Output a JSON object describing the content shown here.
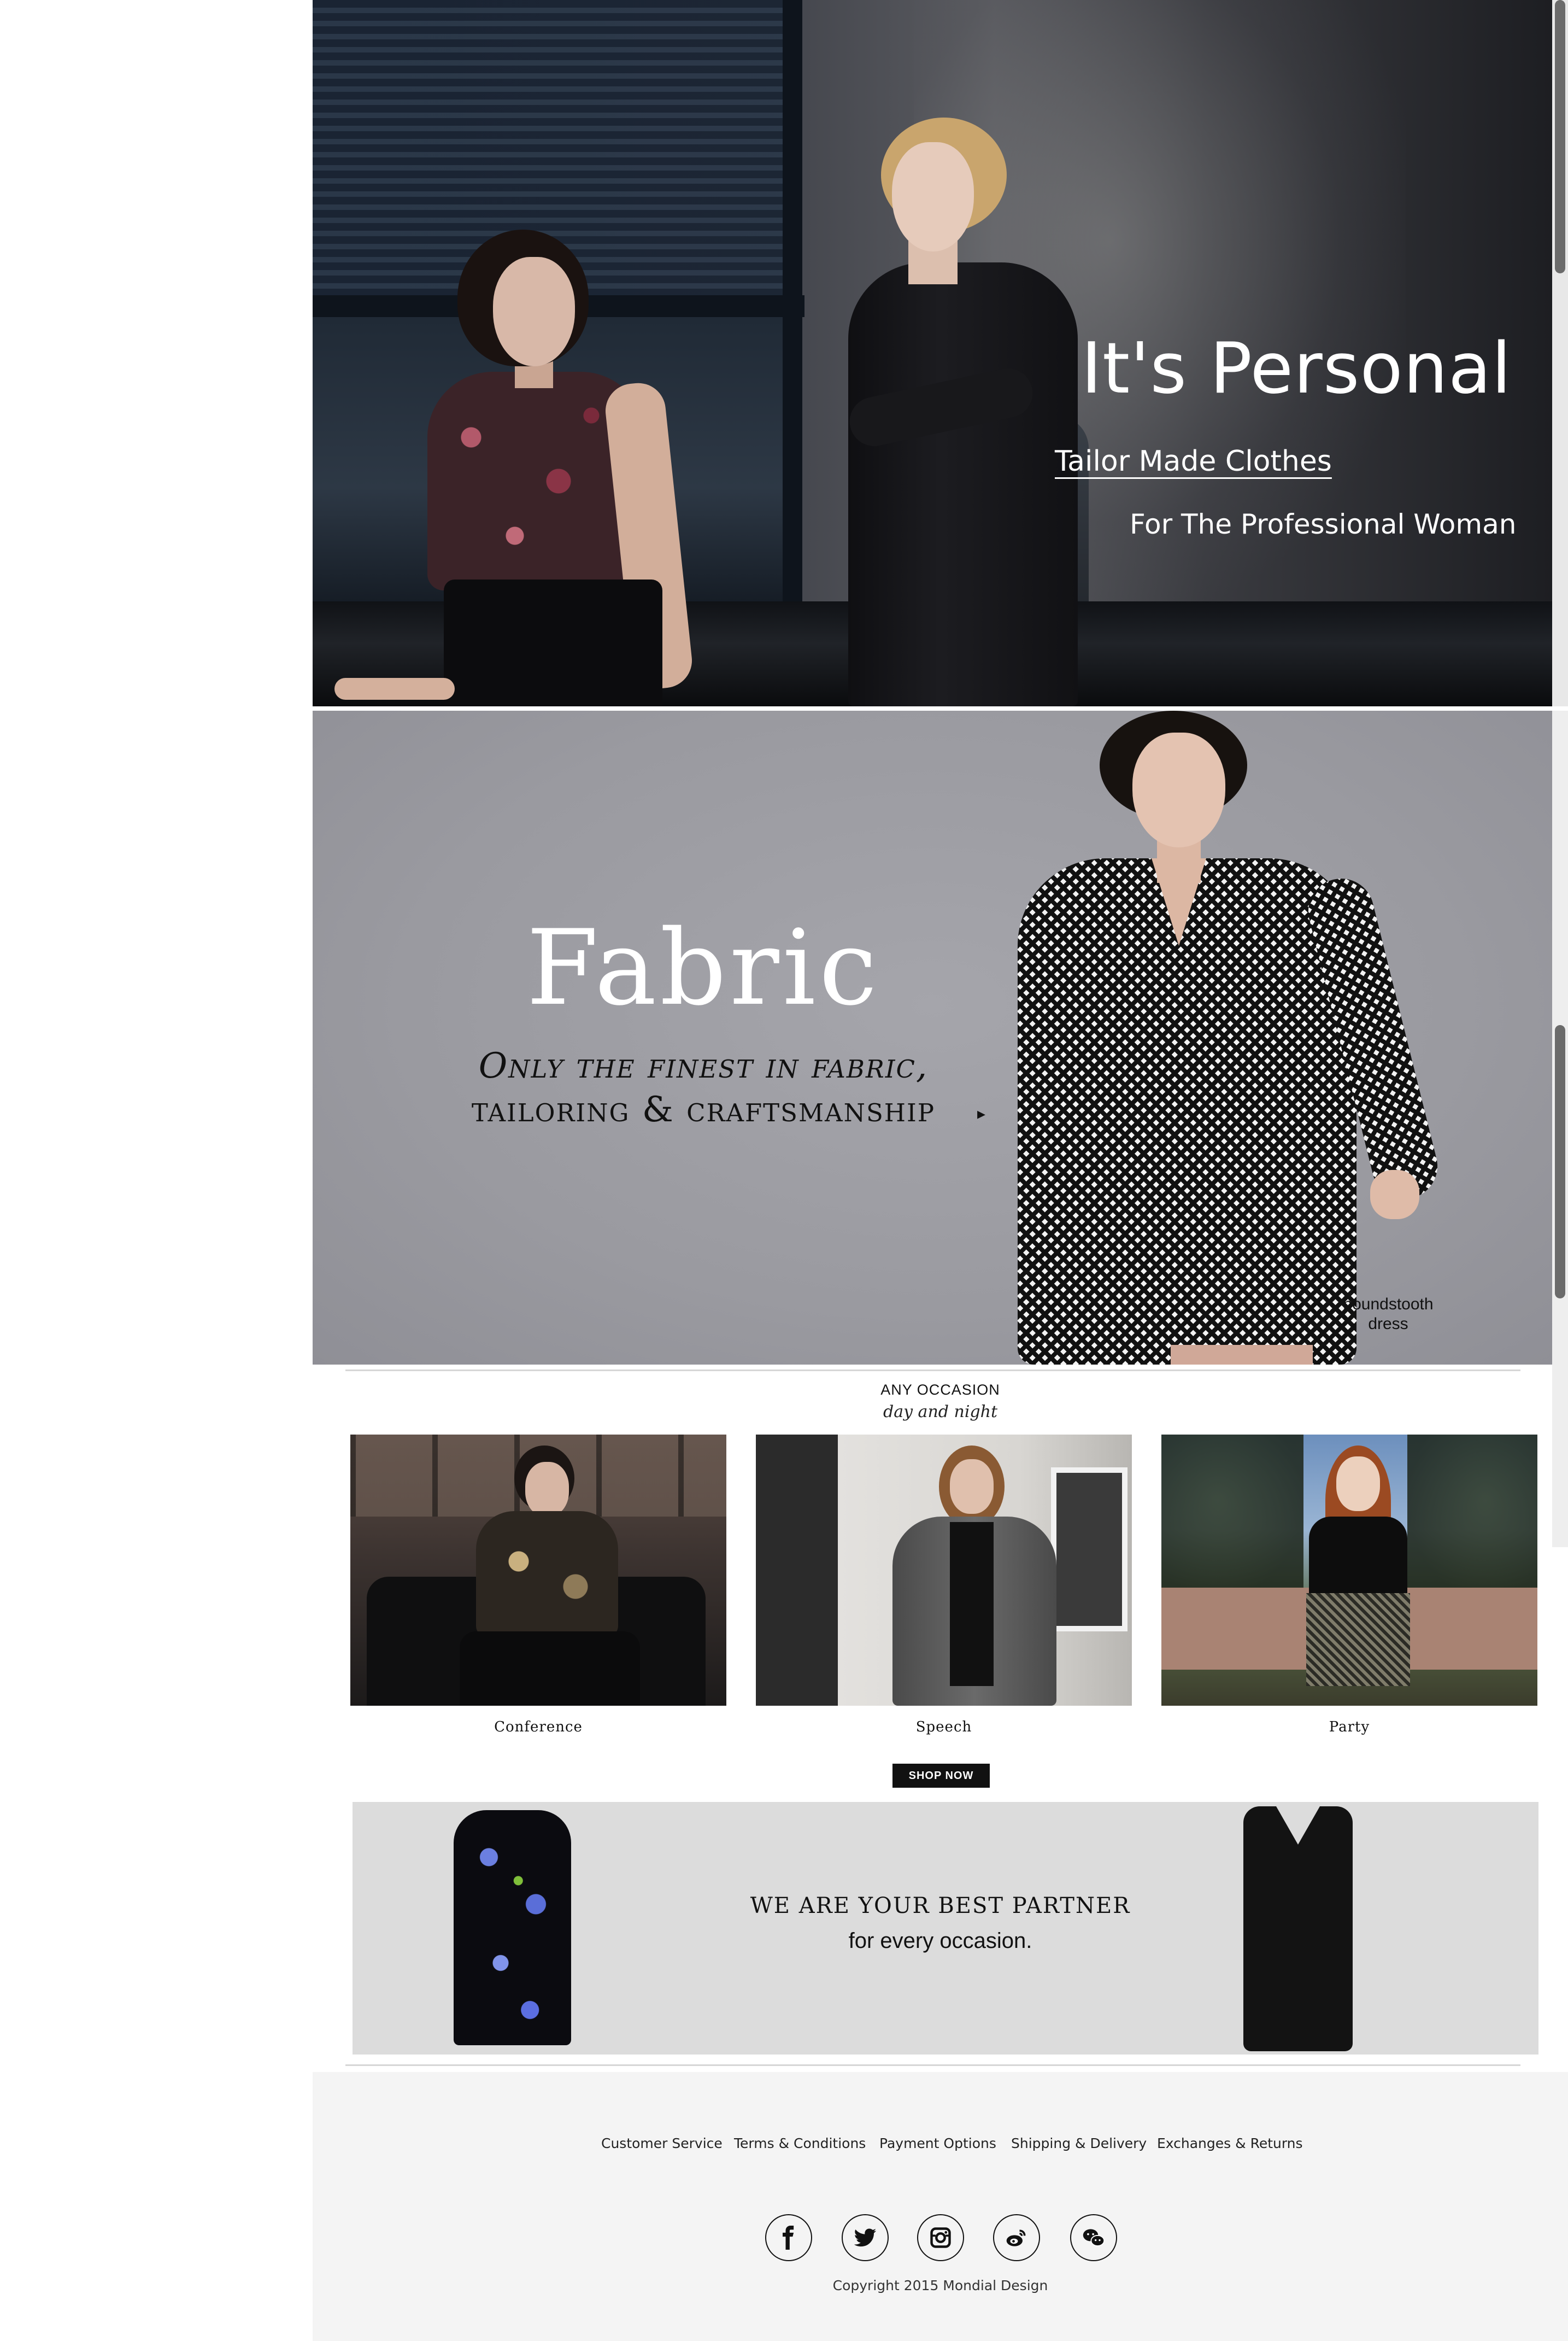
{
  "hero": {
    "title": "It's Personal",
    "link": "Tailor Made Clothes",
    "tagline": "For The Professional Woman"
  },
  "fabric": {
    "title": "Fabric",
    "line1": "Only the finest in fabric,",
    "line2": "tailoring & craftsmanship",
    "arrow": "▸",
    "caption_line1": "houndstooth",
    "caption_line2": "dress"
  },
  "occasion": {
    "title": "ANY OCCASION",
    "subtitle": "day and night",
    "cards": [
      {
        "label": "Conference"
      },
      {
        "label": "Speech"
      },
      {
        "label": "Party"
      }
    ],
    "shop_button": "SHOP NOW"
  },
  "partner": {
    "title": "WE ARE YOUR BEST PARTNER",
    "subtitle": "for every occasion."
  },
  "footer": {
    "links": [
      "Customer Service",
      "Terms & Conditions",
      "Payment Options",
      "Shipping & Delivery",
      "Exchanges & Returns"
    ],
    "social_icons": [
      "facebook-icon",
      "twitter-icon",
      "instagram-icon",
      "weibo-icon",
      "wechat-icon"
    ],
    "copyright": "Copyright 2015 Mondial Design"
  },
  "colors": {
    "page_bg": "#ffffff",
    "footer_bg": "#f4f4f4",
    "fabric_bg": "#9a9aa0",
    "partner_bg": "#dcdcdc",
    "button_bg": "#111111"
  }
}
